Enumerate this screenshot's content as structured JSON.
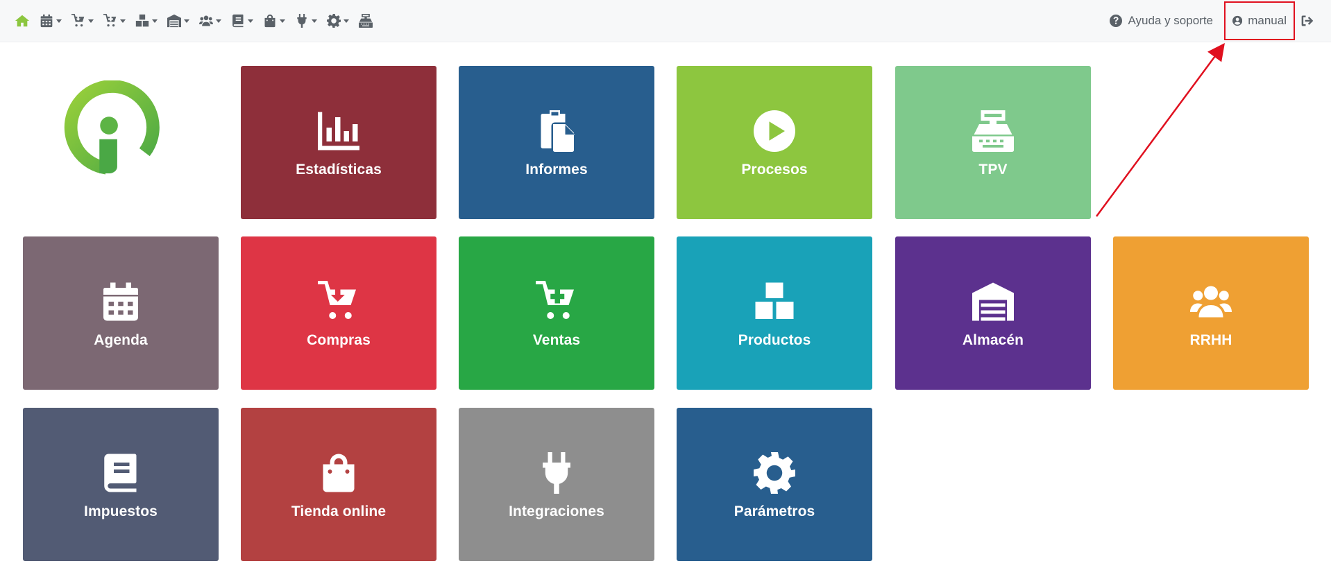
{
  "navbar": {
    "menus": [
      {
        "icon": "calendar-icon"
      },
      {
        "icon": "cart-down-icon"
      },
      {
        "icon": "cart-plus-icon"
      },
      {
        "icon": "boxes-icon"
      },
      {
        "icon": "warehouse-icon"
      },
      {
        "icon": "users-icon"
      },
      {
        "icon": "book-icon"
      },
      {
        "icon": "shopping-bag-icon"
      },
      {
        "icon": "plug-icon"
      },
      {
        "icon": "gear-icon"
      }
    ],
    "help_label": "Ayuda y soporte",
    "user_label": "manual"
  },
  "tiles": [
    {
      "label": "Estadísticas",
      "icon": "chart-bar-icon",
      "color": "#8e2f3a"
    },
    {
      "label": "Informes",
      "icon": "copy-icon",
      "color": "#285e8e"
    },
    {
      "label": "Procesos",
      "icon": "play-circle-icon",
      "color": "#8dc63f"
    },
    {
      "label": "TPV",
      "icon": "cash-register-icon",
      "color": "#7fc98c"
    },
    {
      "label": "Agenda",
      "icon": "calendar-icon",
      "color": "#7c6873"
    },
    {
      "label": "Compras",
      "icon": "cart-down-icon",
      "color": "#de3545"
    },
    {
      "label": "Ventas",
      "icon": "cart-plus-icon",
      "color": "#28a745"
    },
    {
      "label": "Productos",
      "icon": "boxes-icon",
      "color": "#19a2b8"
    },
    {
      "label": "Almacén",
      "icon": "warehouse-icon",
      "color": "#5c318e"
    },
    {
      "label": "RRHH",
      "icon": "users-icon",
      "color": "#efa033"
    },
    {
      "label": "Impuestos",
      "icon": "book-icon",
      "color": "#525b74"
    },
    {
      "label": "Tienda online",
      "icon": "shopping-bag-icon",
      "color": "#b34141"
    },
    {
      "label": "Integraciones",
      "icon": "plug-icon",
      "color": "#8e8e8e"
    },
    {
      "label": "Parámetros",
      "icon": "gear-icon",
      "color": "#285e8e"
    }
  ],
  "colors": {
    "brand_green": "#8cc63f",
    "annotation_red": "#e0101f"
  }
}
